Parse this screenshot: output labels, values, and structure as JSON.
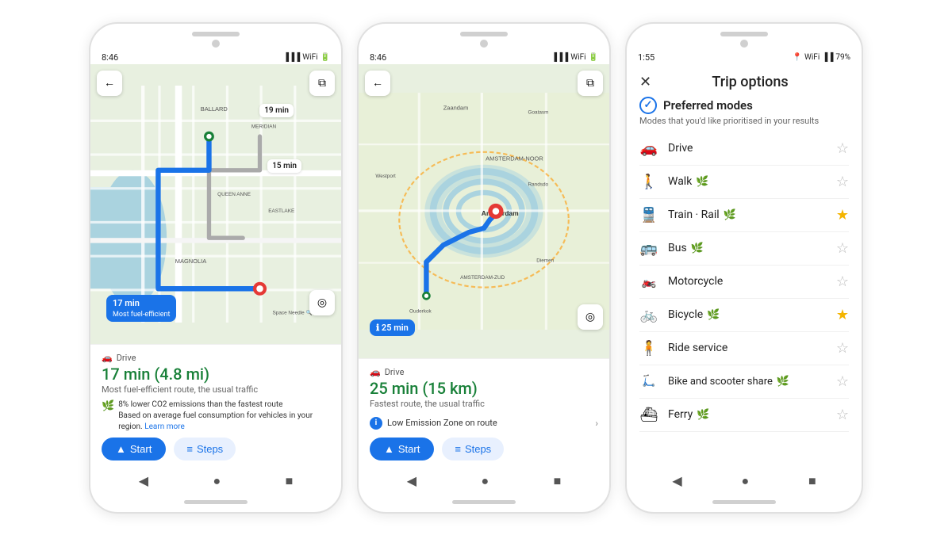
{
  "phone1": {
    "status_time": "8:46",
    "map_back_icon": "◀",
    "map_layers_icon": "⧉",
    "map_compass_icon": "◎",
    "badge_text": "17 min",
    "badge_sub": "Most fuel-efficient",
    "time_badge_1": "19 min",
    "time_badge_2": "15 min",
    "drive_label": "Drive",
    "duration": "17 min (4.8 mi)",
    "route_desc": "Most fuel-efficient route, the usual traffic",
    "eco_text": "8% lower CO2 emissions than the fastest route",
    "eco_sub": "Based on average fuel consumption for vehicles in your region.",
    "eco_link": "Learn more",
    "start_label": "Start",
    "steps_label": "Steps",
    "nav_back": "◀",
    "nav_home": "●",
    "nav_square": "■"
  },
  "phone2": {
    "status_time": "8:46",
    "map_back_icon": "◀",
    "map_layers_icon": "⧉",
    "map_compass_icon": "◎",
    "badge_text": "25 min",
    "time_badge_icon": "ℹ",
    "drive_label": "Drive",
    "duration": "25 min (15 km)",
    "route_desc": "Fastest route, the usual traffic",
    "low_emission_text": "Low Emission Zone on route",
    "start_label": "Start",
    "steps_label": "Steps",
    "nav_back": "◀",
    "nav_home": "●",
    "nav_square": "■"
  },
  "phone3": {
    "status_time": "1:55",
    "status_battery": "79%",
    "close_icon": "✕",
    "title": "Trip options",
    "preferred_modes_heading": "Preferred modes",
    "preferred_modes_sub": "Modes that you'd like prioritised in your results",
    "modes": [
      {
        "icon": "🚗",
        "name": "Drive",
        "leaf": false,
        "starred": false
      },
      {
        "icon": "🚶",
        "name": "Walk",
        "leaf": true,
        "starred": false
      },
      {
        "icon": "🚆",
        "name": "Train · Rail",
        "leaf": true,
        "starred": true
      },
      {
        "icon": "🚌",
        "name": "Bus",
        "leaf": true,
        "starred": false
      },
      {
        "icon": "🏍",
        "name": "Motorcycle",
        "leaf": false,
        "starred": false
      },
      {
        "icon": "🚲",
        "name": "Bicycle",
        "leaf": true,
        "starred": true
      },
      {
        "icon": "🧍",
        "name": "Ride service",
        "leaf": false,
        "starred": false
      },
      {
        "icon": "🛴",
        "name": "Bike and scooter share",
        "leaf": true,
        "starred": false
      },
      {
        "icon": "⛴",
        "name": "Ferry",
        "leaf": true,
        "starred": false
      }
    ],
    "nav_back": "◀",
    "nav_home": "●",
    "nav_square": "■"
  }
}
